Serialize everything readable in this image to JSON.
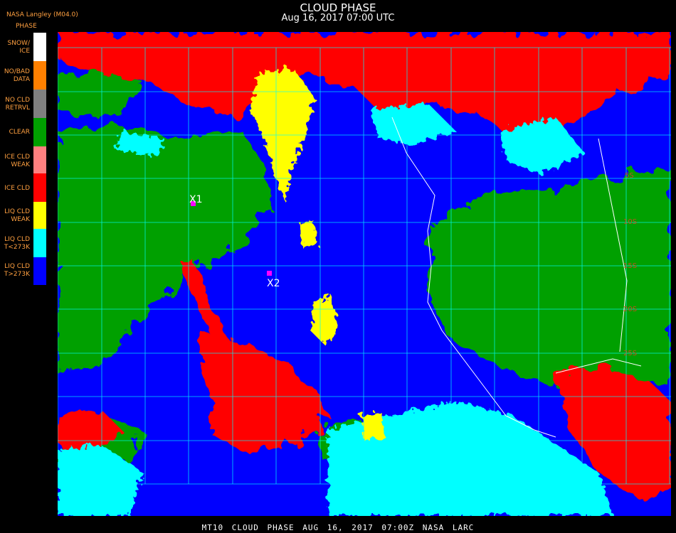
{
  "header": {
    "title": "CLOUD PHASE",
    "subtitle": "Aug 16, 2017 07:00 UTC",
    "producer": "NASA Langley (M04.0)"
  },
  "legend": {
    "title": "PHASE",
    "items": [
      {
        "label": "SNOW/\nICE",
        "color": "#ffffff"
      },
      {
        "label": "NO/BAD\nDATA",
        "color": "#ff8000"
      },
      {
        "label": "NO CLD\nRETRVL",
        "color": "#808080"
      },
      {
        "label": "CLEAR",
        "color": "#00a000"
      },
      {
        "label": "ICE CLD\nWEAK",
        "color": "#ff8080"
      },
      {
        "label": "ICE CLD",
        "color": "#ff0000"
      },
      {
        "label": "LIQ CLD\nWEAK",
        "color": "#ffff00"
      },
      {
        "label": "LIQ CLD\nT<273K",
        "color": "#00ffff"
      },
      {
        "label": "LIQ CLD\nT>273K",
        "color": "#0000ff"
      }
    ]
  },
  "map": {
    "markers": [
      {
        "label": "X1"
      },
      {
        "label": "X2"
      }
    ],
    "lat_labels": [
      "5S",
      "10S",
      "15S",
      "20S",
      "25S"
    ],
    "colors": {
      "grid": "#00ffff",
      "coast": "#ffffff",
      "marker": "#ff00ff",
      "lat_label": "#c05020"
    }
  },
  "footer": "MT10 CLOUD PHASE AUG 16, 2017 07:00Z NASA LARC"
}
